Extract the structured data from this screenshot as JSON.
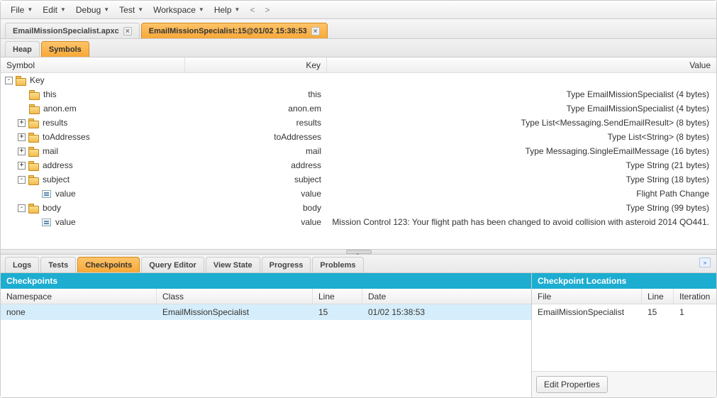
{
  "menu": {
    "items": [
      "File",
      "Edit",
      "Debug",
      "Test",
      "Workspace",
      "Help"
    ],
    "nav": [
      "<",
      ">"
    ]
  },
  "editor_tabs": [
    {
      "label": "EmailMissionSpecialist.apxc",
      "active": false
    },
    {
      "label": "EmailMissionSpecialist:15@01/02 15:38:53",
      "active": true
    }
  ],
  "sub_tabs": [
    {
      "label": "Heap",
      "active": false
    },
    {
      "label": "Symbols",
      "active": true
    }
  ],
  "symbols": {
    "columns": {
      "symbol": "Symbol",
      "key": "Key",
      "value": "Value"
    },
    "rows": [
      {
        "toggle": "-",
        "indent": 0,
        "icon": "folder",
        "symbol": "Key",
        "key": "",
        "value": ""
      },
      {
        "toggle": "",
        "indent": 1,
        "icon": "folder",
        "symbol": "this",
        "key": "this",
        "value": "Type EmailMissionSpecialist (4 bytes)"
      },
      {
        "toggle": "",
        "indent": 1,
        "icon": "folder",
        "symbol": "anon.em",
        "key": "anon.em",
        "value": "Type EmailMissionSpecialist (4 bytes)"
      },
      {
        "toggle": "+",
        "indent": 1,
        "icon": "folder",
        "symbol": "results",
        "key": "results",
        "value": "Type List<Messaging.SendEmailResult> (8 bytes)"
      },
      {
        "toggle": "+",
        "indent": 1,
        "icon": "folder",
        "symbol": "toAddresses",
        "key": "toAddresses",
        "value": "Type List<String> (8 bytes)"
      },
      {
        "toggle": "+",
        "indent": 1,
        "icon": "folder",
        "symbol": "mail",
        "key": "mail",
        "value": "Type Messaging.SingleEmailMessage (16 bytes)"
      },
      {
        "toggle": "+",
        "indent": 1,
        "icon": "folder",
        "symbol": "address",
        "key": "address",
        "value": "Type String (21 bytes)"
      },
      {
        "toggle": "-",
        "indent": 1,
        "icon": "folder",
        "symbol": "subject",
        "key": "subject",
        "value": "Type String (18 bytes)"
      },
      {
        "toggle": "",
        "indent": 2,
        "icon": "value",
        "symbol": "value",
        "key": "value",
        "value": "Flight Path Change"
      },
      {
        "toggle": "-",
        "indent": 1,
        "icon": "folder",
        "symbol": "body",
        "key": "body",
        "value": "Type String (99 bytes)"
      },
      {
        "toggle": "",
        "indent": 2,
        "icon": "value",
        "symbol": "value",
        "key": "value",
        "value": "Mission Control 123: Your flight path has been changed to avoid collision with asteroid 2014 QO441."
      }
    ]
  },
  "bottom_tabs": [
    {
      "label": "Logs",
      "active": false
    },
    {
      "label": "Tests",
      "active": false
    },
    {
      "label": "Checkpoints",
      "active": true
    },
    {
      "label": "Query Editor",
      "active": false
    },
    {
      "label": "View State",
      "active": false
    },
    {
      "label": "Progress",
      "active": false
    },
    {
      "label": "Problems",
      "active": false
    }
  ],
  "checkpoints": {
    "title": "Checkpoints",
    "columns": {
      "namespace": "Namespace",
      "class": "Class",
      "line": "Line",
      "date": "Date"
    },
    "rows": [
      {
        "namespace": "none",
        "class": "EmailMissionSpecialist",
        "line": "15",
        "date": "01/02 15:38:53"
      }
    ]
  },
  "locations": {
    "title": "Checkpoint Locations",
    "columns": {
      "file": "File",
      "line": "Line",
      "iteration": "Iteration"
    },
    "rows": [
      {
        "file": "EmailMissionSpecialist",
        "line": "15",
        "iteration": "1"
      }
    ],
    "edit_button": "Edit Properties"
  }
}
